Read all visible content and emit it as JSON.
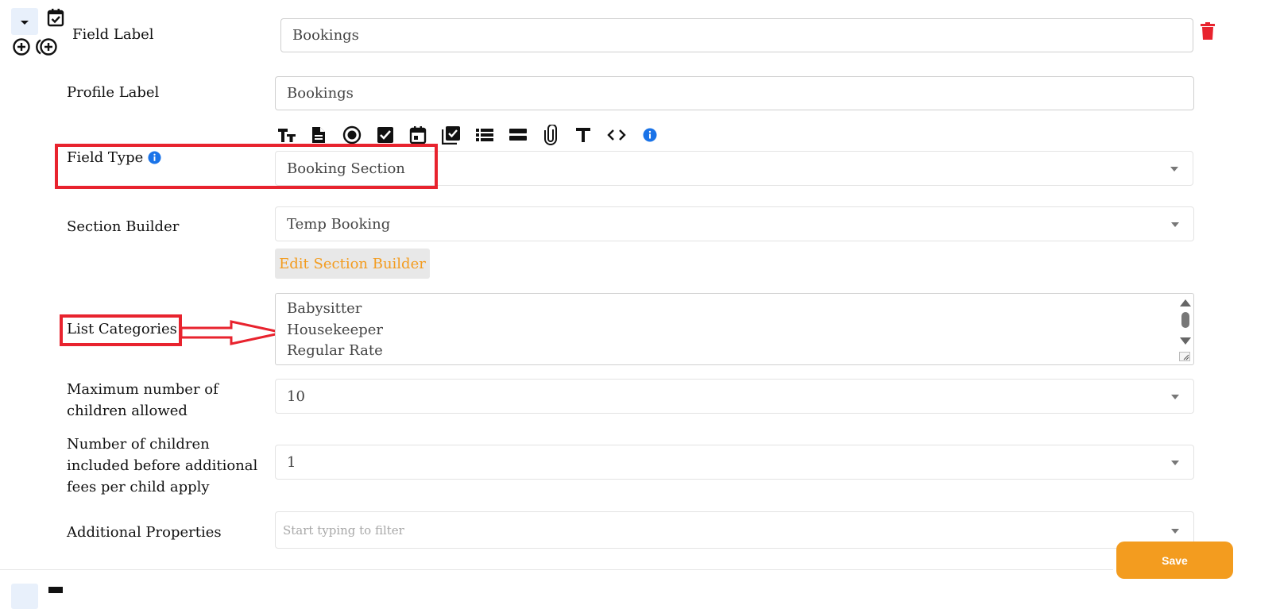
{
  "form": {
    "field_label": {
      "label": "Field Label",
      "value": "Bookings"
    },
    "profile_label": {
      "label": "Profile Label",
      "value": "Bookings"
    },
    "field_type": {
      "label": "Field Type",
      "value": "Booking Section"
    },
    "section_builder": {
      "label": "Section Builder",
      "value": "Temp Booking",
      "edit_button": "Edit Section Builder"
    },
    "list_categories": {
      "label": "List Categories",
      "items": [
        "Babysitter",
        "Housekeeper",
        "Regular Rate"
      ]
    },
    "max_children": {
      "label_line1": "Maximum number of",
      "label_line2": "children allowed",
      "value": "10"
    },
    "children_included": {
      "label_line1": "Number of children",
      "label_line2": "included before additional",
      "label_line3": "fees per child apply",
      "value": "1"
    },
    "additional_properties": {
      "label": "Additional Properties",
      "placeholder": "Start typing to filter"
    }
  },
  "save_button": "Save",
  "toolbar_icons": [
    "text-size-icon",
    "document-icon",
    "radio-icon",
    "checkbox-icon",
    "calendar-icon",
    "multi-checkbox-icon",
    "list-icon",
    "section-icon",
    "attachment-icon",
    "text-icon",
    "code-icon",
    "info-icon"
  ],
  "colors": {
    "accent": "#f39c1f",
    "annotation": "#e8232e",
    "info": "#1a73e8",
    "delete": "#e8232e"
  }
}
